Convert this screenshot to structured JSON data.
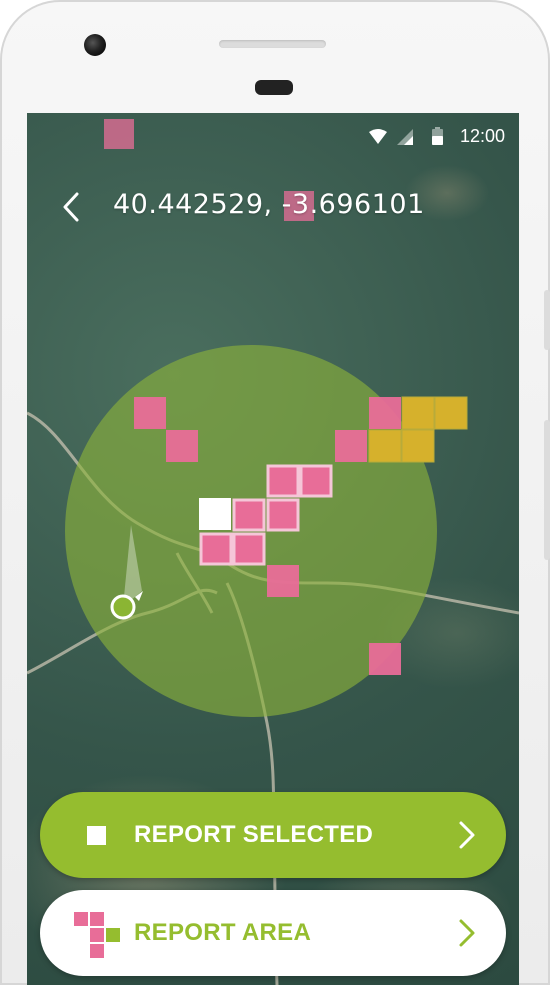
{
  "status_bar": {
    "time": "12:00"
  },
  "header": {
    "coordinates": "40.442529, -3.696101"
  },
  "map": {
    "selection_colors": {
      "reported": "#e3709b",
      "alert": "#d6b12c",
      "selected": "#ffffff",
      "radius": "#8db33a"
    }
  },
  "actions": {
    "report_selected": "REPORT SELECTED",
    "report_area": "REPORT AREA"
  },
  "colors": {
    "accent": "#95bd2f",
    "pink": "#e86d98"
  }
}
